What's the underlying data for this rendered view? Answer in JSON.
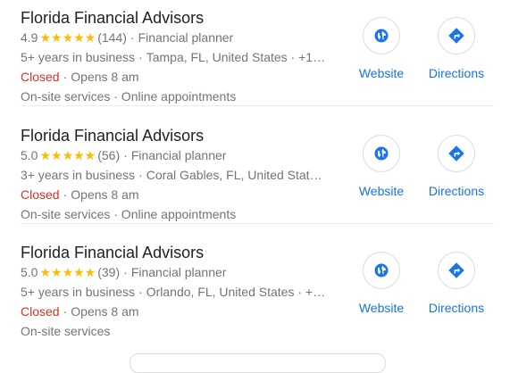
{
  "listings": [
    {
      "name": "Florida Financial Advisors",
      "rating": "4.9",
      "stars": "★★★★★",
      "reviews": "(144)",
      "category": "Financial planner",
      "years": "5+ years in business",
      "location": "Tampa, FL, United States · +1…",
      "status": "Closed",
      "opens": "Opens 8 am",
      "services": "On-site services · Online appointments",
      "website_label": "Website",
      "directions_label": "Directions"
    },
    {
      "name": "Florida Financial Advisors",
      "rating": "5.0",
      "stars": "★★★★★",
      "reviews": "(56)",
      "category": "Financial planner",
      "years": "3+ years in business",
      "location": "Coral Gables, FL, United Stat…",
      "status": "Closed",
      "opens": "Opens 8 am",
      "services": "On-site services · Online appointments",
      "website_label": "Website",
      "directions_label": "Directions"
    },
    {
      "name": "Florida Financial Advisors",
      "rating": "5.0",
      "stars": "★★★★★",
      "reviews": "(39)",
      "category": "Financial planner",
      "years": "5+ years in business",
      "location": "Orlando, FL, United States · +…",
      "status": "Closed",
      "opens": "Opens 8 am",
      "services": "On-site services",
      "website_label": "Website",
      "directions_label": "Directions"
    }
  ],
  "colors": {
    "star": "#fbbc04",
    "closed": "#d93025",
    "link": "#1a73e8",
    "icon": "#1a73e8"
  },
  "icons": {
    "website": "globe-icon",
    "directions": "directions-icon"
  }
}
